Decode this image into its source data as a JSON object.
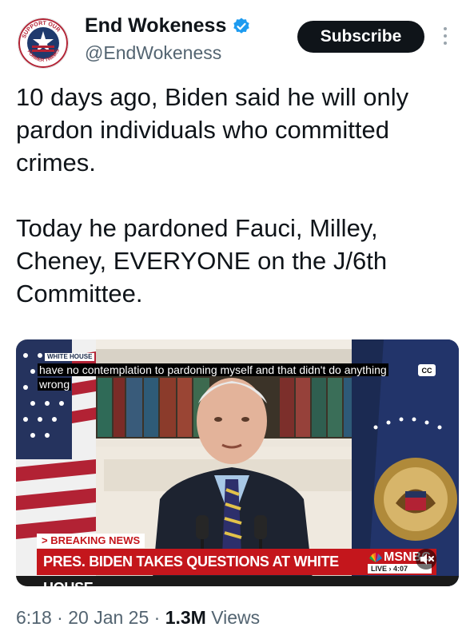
{
  "author": {
    "display_name": "End Wokeness",
    "handle": "@EndWokeness",
    "avatar_text_top": "SUPPORT OUR",
    "avatar_text_bottom": "FORMER TWINKS"
  },
  "subscribe_label": "Subscribe",
  "tweet": {
    "text": "10 days ago, Biden said he will only pardon individuals who committed crimes.\n\nToday he pardoned Fauci, Milley, Cheney, EVERYONE on the J/6th Committee."
  },
  "video": {
    "white_house_tag": "WHITE HOUSE",
    "caption": "have no contemplation to pardoning myself and that didn't do anything wrong",
    "cc_label": "CC",
    "breaking_label": "> BREAKING NEWS",
    "headline": "PRES. BIDEN TAKES QUESTIONS AT WHITE HOUSE",
    "network": "MSNBC",
    "live_label": "LIVE",
    "live_time": "4:07"
  },
  "meta": {
    "time": "6:18",
    "sep1": " · ",
    "date": "20 Jan 25",
    "sep2": " · ",
    "views_count": "1.3M",
    "views_label": " Views"
  },
  "colors": {
    "verified_blue": "#1d9bf0",
    "breaking_red": "#c4161c",
    "text_dark": "#0f1419",
    "text_muted": "#536471"
  },
  "icons": [
    "verified-badge-icon",
    "more-options-icon",
    "cc-icon",
    "mute-icon"
  ]
}
